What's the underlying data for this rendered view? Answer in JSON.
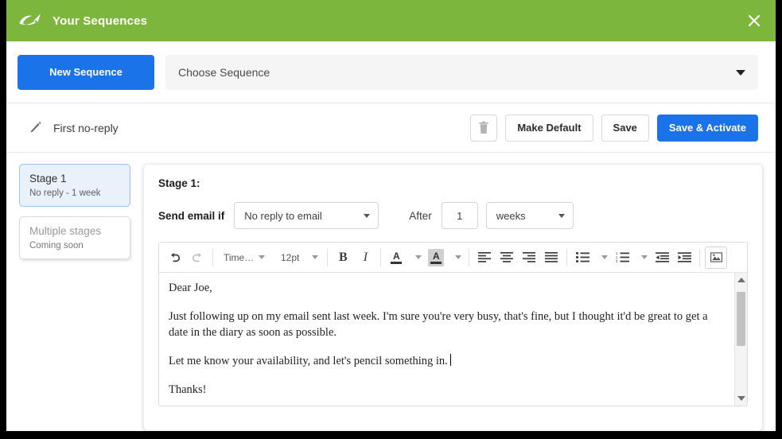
{
  "window": {
    "title": "Your Sequences",
    "logo_icon": "swoosh-logo-icon",
    "close_icon": "close-icon",
    "header_color": "#7db63c",
    "accent_color": "#1a73e8"
  },
  "sequence_bar": {
    "new_button": "New Sequence",
    "choose_placeholder": "Choose Sequence",
    "dropdown_icon": "chevron-down-icon"
  },
  "action_bar": {
    "edit_icon": "pencil-icon",
    "sequence_name": "First no-reply",
    "delete_icon": "trash-icon",
    "make_default": "Make Default",
    "save": "Save",
    "save_activate": "Save & Activate"
  },
  "stages": [
    {
      "title": "Stage 1",
      "subtitle": "No reply - 1 week",
      "selected": true
    },
    {
      "title": "Multiple stages",
      "subtitle": "Coming soon",
      "selected": false
    }
  ],
  "panel": {
    "title": "Stage 1:",
    "condition_label": "Send email if",
    "condition_value": "No reply to email",
    "after_label": "After",
    "after_value": "1",
    "unit_value": "weeks"
  },
  "toolbar": {
    "undo_icon": "undo-icon",
    "redo_icon": "redo-icon",
    "font_family": "Time…",
    "font_size": "12pt",
    "bold": "B",
    "italic": "I",
    "text_color_icon": "text-color-icon",
    "highlight_color_icon": "highlight-color-icon",
    "align_left_icon": "align-left-icon",
    "align_center_icon": "align-center-icon",
    "align_right_icon": "align-right-icon",
    "align_justify_icon": "align-justify-icon",
    "bullet_list_icon": "bullet-list-icon",
    "numbered_list_icon": "numbered-list-icon",
    "outdent_icon": "outdent-icon",
    "indent_icon": "indent-icon",
    "image_icon": "insert-image-icon"
  },
  "email_body": {
    "paragraphs": [
      "Dear Joe,",
      "Just following up on my email sent last week. I'm sure you're very busy, that's fine, but I thought it'd be great to get a date in the diary as soon as possible.",
      "Let me know your availability, and let's pencil something in.",
      "Thanks!"
    ]
  },
  "scrollbar": {
    "up_icon": "scroll-up-icon",
    "down_icon": "scroll-down-icon"
  }
}
